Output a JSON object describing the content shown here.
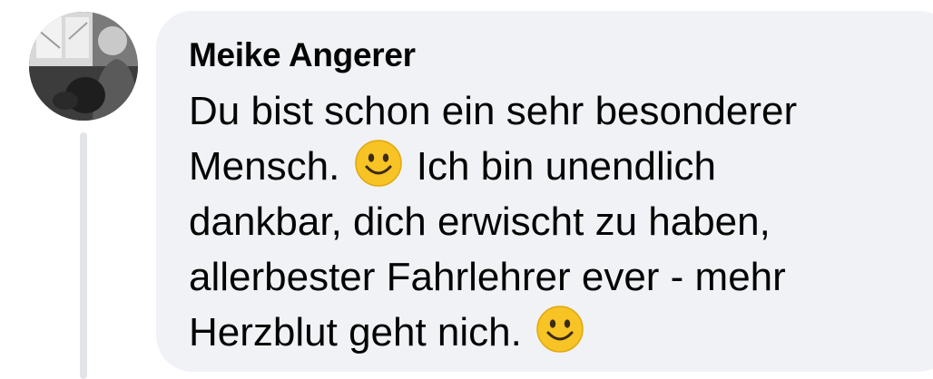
{
  "comment": {
    "author": "Meike Angerer",
    "lines": [
      {
        "before": "Du bist schon ein sehr besonderer",
        "emoji": null,
        "after": ""
      },
      {
        "before": "Mensch.",
        "emoji": "smiling-face-icon",
        "after": "Ich bin unendlich"
      },
      {
        "before": "dankbar, dich erwischt zu haben,",
        "emoji": null,
        "after": ""
      },
      {
        "before": "allerbester Fahrlehrer ever - mehr",
        "emoji": null,
        "after": ""
      },
      {
        "before": "Herzblut geht nich.",
        "emoji": "smiling-face-icon",
        "after": ""
      }
    ]
  },
  "colors": {
    "bubble_bg": "#f0f2f5",
    "text": "#050505",
    "thread_line": "#e2e4e8",
    "emoji_face": "#f7c325"
  }
}
